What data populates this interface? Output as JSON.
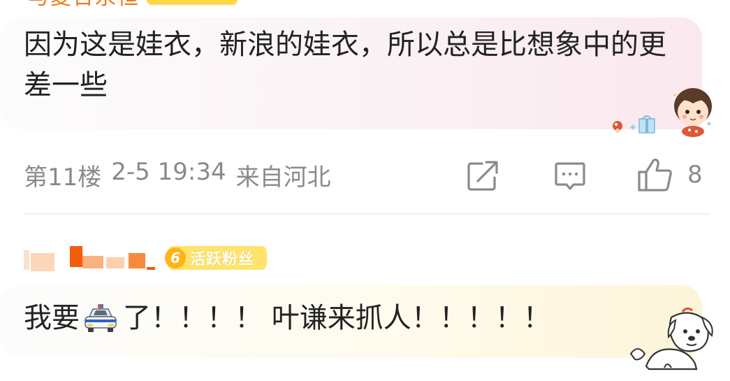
{
  "top_user": {
    "name": "与夏日永恒"
  },
  "comment_1": {
    "text": "因为这是娃衣，新浪的娃衣，所以总是比想象中的更差一些",
    "floor": "第11楼",
    "time": "2-5 19:34",
    "location": "来自河北",
    "like_count": "8"
  },
  "comment_2": {
    "fan_level": "6",
    "fan_label": "活跃粉丝",
    "text_before": "我要",
    "text_after": "了！！！！ 叶谦来抓人！！！！！",
    "emoji": "police-car"
  },
  "icons": {
    "share": "share-icon",
    "comment": "comment-icon",
    "like": "thumbs-up-icon"
  },
  "colors": {
    "username": "#f07a1a",
    "badge": "#ffe36b",
    "meta_text": "#8a8a8a",
    "body_text": "#222222"
  }
}
